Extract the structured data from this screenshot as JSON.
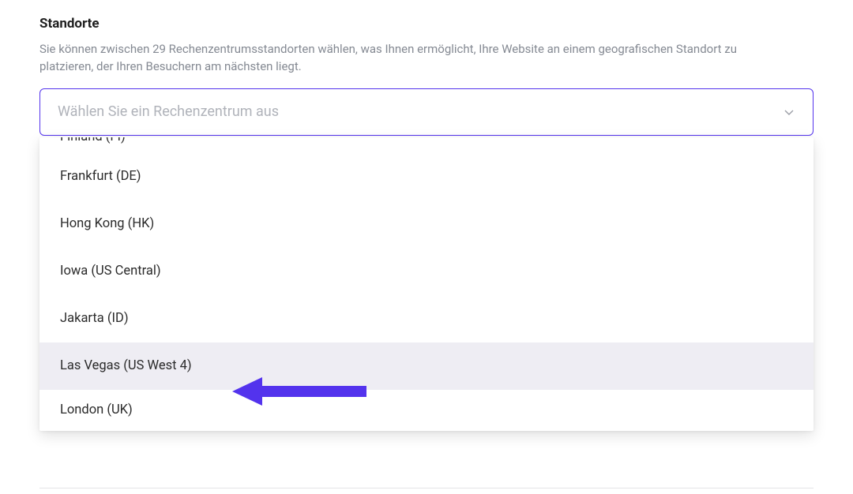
{
  "section": {
    "heading": "Standorte",
    "description": "Sie können zwischen 29 Rechenzentrumsstandorten wählen, was Ihnen ermöglicht, Ihre Website an einem geografischen Standort zu platzieren, der Ihren Besuchern am nächsten liegt."
  },
  "select": {
    "placeholder": "Wählen Sie ein Rechenzentrum aus"
  },
  "options": {
    "0": {
      "label": "Finland (FI)"
    },
    "1": {
      "label": "Frankfurt (DE)"
    },
    "2": {
      "label": "Hong Kong (HK)"
    },
    "3": {
      "label": "Iowa (US Central)"
    },
    "4": {
      "label": "Jakarta (ID)"
    },
    "5": {
      "label": "Las Vegas (US West 4)"
    },
    "6": {
      "label": "London (UK)"
    }
  },
  "colors": {
    "accent": "#5333ed"
  }
}
